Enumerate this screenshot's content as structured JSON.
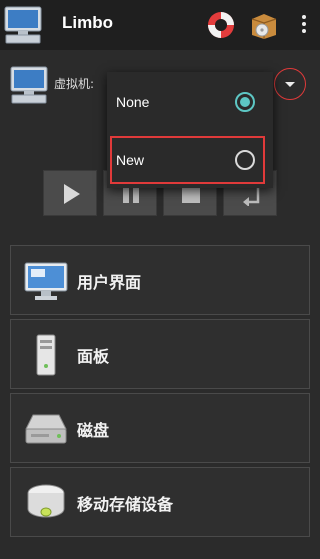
{
  "appbar": {
    "title": "Limbo",
    "icons": [
      "computer-icon",
      "lifebuoy-icon",
      "package-icon",
      "more-vert-icon"
    ]
  },
  "vm": {
    "label": "虚拟机:",
    "selected": "None"
  },
  "dropdown": {
    "options": [
      {
        "label": "None",
        "checked": true
      },
      {
        "label": "New",
        "checked": false
      }
    ],
    "accent": "#5dc7c4",
    "highlight": "#e03a3a"
  },
  "controls": [
    "play-icon",
    "pause-icon",
    "stop-icon",
    "restart-icon"
  ],
  "menu": [
    {
      "label": "用户界面",
      "icon": "display-icon"
    },
    {
      "label": "面板",
      "icon": "tower-icon"
    },
    {
      "label": "磁盘",
      "icon": "hard-disk-icon"
    },
    {
      "label": "移动存储设备",
      "icon": "removable-drive-icon"
    }
  ]
}
